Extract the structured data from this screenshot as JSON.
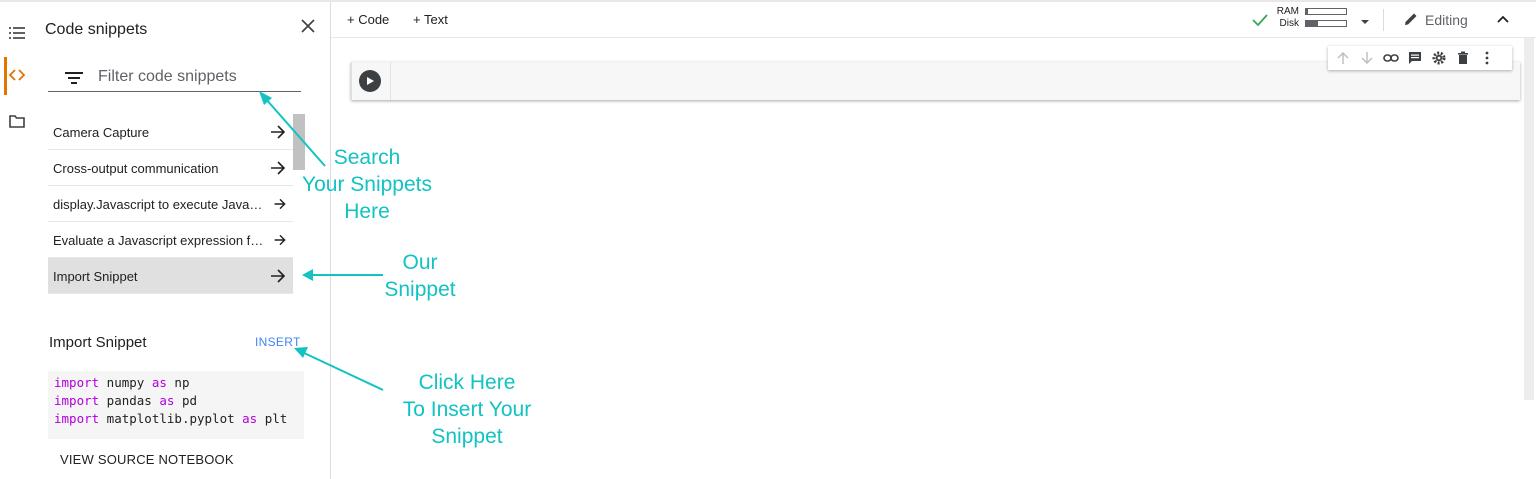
{
  "rail": {
    "icons": [
      "table-of-contents-icon",
      "code-snippets-icon",
      "files-icon"
    ]
  },
  "panel": {
    "title": "Code snippets",
    "filter_placeholder": "Filter code snippets",
    "items": [
      {
        "label": "Camera Capture"
      },
      {
        "label": "Cross-output communication"
      },
      {
        "label": "display.Javascript to execute JavaScript from Python"
      },
      {
        "label": "Evaluate a Javascript expression from Python"
      },
      {
        "label": "Import Snippet",
        "selected": true
      }
    ],
    "detail": {
      "title": "Import Snippet",
      "insert_label": "INSERT",
      "code_lines": [
        {
          "kw1": "import",
          "mod": " numpy ",
          "kw2": "as",
          "alias": " np"
        },
        {
          "kw1": "import",
          "mod": " pandas ",
          "kw2": "as",
          "alias": " pd"
        },
        {
          "kw1": "import",
          "mod": " matplotlib.pyplot ",
          "kw2": "as",
          "alias": " plt"
        }
      ],
      "view_source_label": "VIEW SOURCE NOTEBOOK"
    }
  },
  "toolbar": {
    "add_code": "+ Code",
    "add_text": "+ Text",
    "ram_label": "RAM",
    "disk_label": "Disk",
    "ram_usage": 0.05,
    "disk_usage": 0.3,
    "editing_label": "Editing"
  },
  "annotations": {
    "search": "Search\nYour Snippets\nHere",
    "our_snippet": "Our\nSnippet",
    "click_insert": "Click Here\nTo Insert Your\nSnippet"
  },
  "colors": {
    "accent_orange": "#e37400",
    "annotation_cyan": "#13c2c2",
    "insert_blue": "#4285f4",
    "keyword_purple": "#af00db",
    "check_green": "#34a853"
  }
}
